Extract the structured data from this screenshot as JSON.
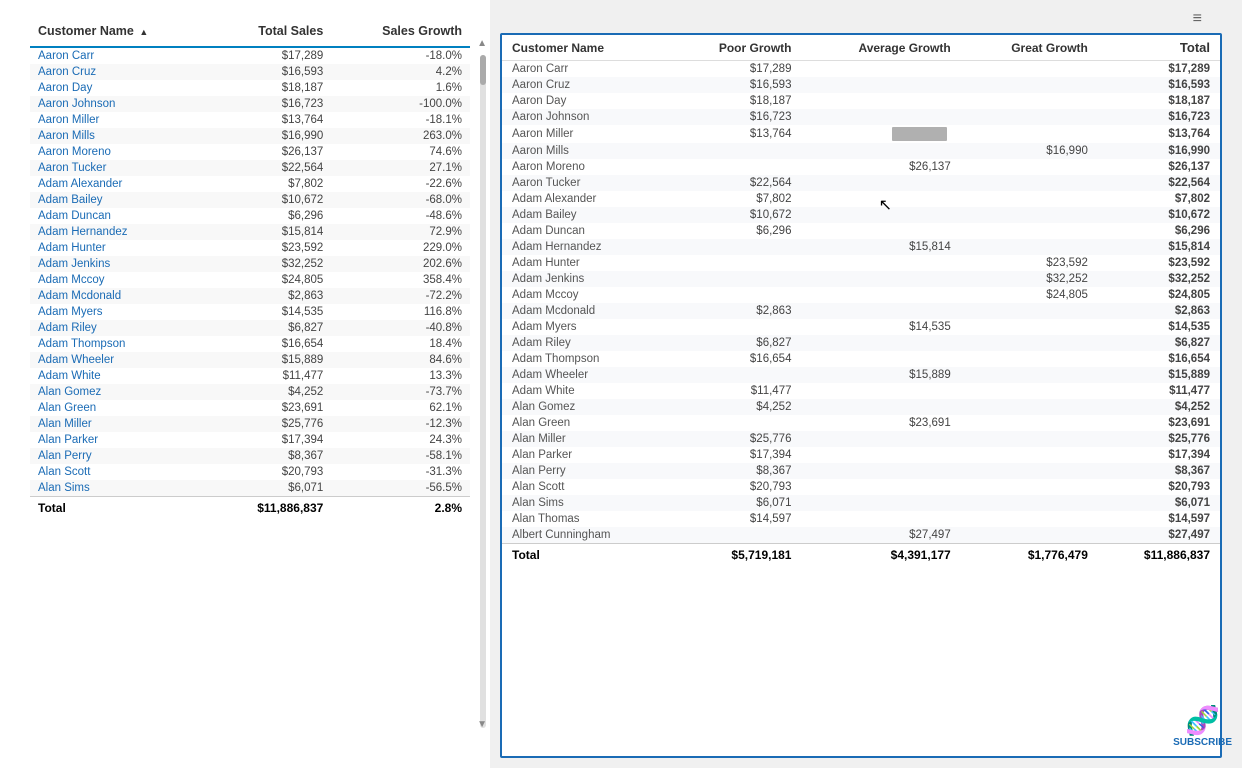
{
  "left": {
    "columns": [
      "Customer Name",
      "Total Sales",
      "Sales Growth"
    ],
    "rows": [
      [
        "Aaron Carr",
        "$17,289",
        "-18.0%"
      ],
      [
        "Aaron Cruz",
        "$16,593",
        "4.2%"
      ],
      [
        "Aaron Day",
        "$18,187",
        "1.6%"
      ],
      [
        "Aaron Johnson",
        "$16,723",
        "-100.0%"
      ],
      [
        "Aaron Miller",
        "$13,764",
        "-18.1%"
      ],
      [
        "Aaron Mills",
        "$16,990",
        "263.0%"
      ],
      [
        "Aaron Moreno",
        "$26,137",
        "74.6%"
      ],
      [
        "Aaron Tucker",
        "$22,564",
        "27.1%"
      ],
      [
        "Adam Alexander",
        "$7,802",
        "-22.6%"
      ],
      [
        "Adam Bailey",
        "$10,672",
        "-68.0%"
      ],
      [
        "Adam Duncan",
        "$6,296",
        "-48.6%"
      ],
      [
        "Adam Hernandez",
        "$15,814",
        "72.9%"
      ],
      [
        "Adam Hunter",
        "$23,592",
        "229.0%"
      ],
      [
        "Adam Jenkins",
        "$32,252",
        "202.6%"
      ],
      [
        "Adam Mccoy",
        "$24,805",
        "358.4%"
      ],
      [
        "Adam Mcdonald",
        "$2,863",
        "-72.2%"
      ],
      [
        "Adam Myers",
        "$14,535",
        "116.8%"
      ],
      [
        "Adam Riley",
        "$6,827",
        "-40.8%"
      ],
      [
        "Adam Thompson",
        "$16,654",
        "18.4%"
      ],
      [
        "Adam Wheeler",
        "$15,889",
        "84.6%"
      ],
      [
        "Adam White",
        "$11,477",
        "13.3%"
      ],
      [
        "Alan Gomez",
        "$4,252",
        "-73.7%"
      ],
      [
        "Alan Green",
        "$23,691",
        "62.1%"
      ],
      [
        "Alan Miller",
        "$25,776",
        "-12.3%"
      ],
      [
        "Alan Parker",
        "$17,394",
        "24.3%"
      ],
      [
        "Alan Perry",
        "$8,367",
        "-58.1%"
      ],
      [
        "Alan Scott",
        "$20,793",
        "-31.3%"
      ],
      [
        "Alan Sims",
        "$6,071",
        "-56.5%"
      ]
    ],
    "footer": [
      "Total",
      "$11,886,837",
      "2.8%"
    ]
  },
  "right": {
    "title": "Customer Name",
    "columns": [
      "Customer Name",
      "Poor Growth",
      "Average Growth",
      "Great Growth",
      "Total"
    ],
    "rows": [
      [
        "Aaron Carr",
        "$17,289",
        "",
        "",
        "$17,289"
      ],
      [
        "Aaron Cruz",
        "$16,593",
        "",
        "",
        "$16,593"
      ],
      [
        "Aaron Day",
        "$18,187",
        "",
        "",
        "$18,187"
      ],
      [
        "Aaron Johnson",
        "$16,723",
        "",
        "",
        "$16,723"
      ],
      [
        "Aaron Miller",
        "$13,764",
        "BAR",
        "",
        "$13,764"
      ],
      [
        "Aaron Mills",
        "",
        "",
        "$16,990",
        "$16,990"
      ],
      [
        "Aaron Moreno",
        "",
        "$26,137",
        "",
        "$26,137"
      ],
      [
        "Aaron Tucker",
        "$22,564",
        "",
        "",
        "$22,564"
      ],
      [
        "Adam Alexander",
        "$7,802",
        "",
        "",
        "$7,802"
      ],
      [
        "Adam Bailey",
        "$10,672",
        "",
        "",
        "$10,672"
      ],
      [
        "Adam Duncan",
        "$6,296",
        "",
        "",
        "$6,296"
      ],
      [
        "Adam Hernandez",
        "",
        "$15,814",
        "",
        "$15,814"
      ],
      [
        "Adam Hunter",
        "",
        "",
        "$23,592",
        "$23,592"
      ],
      [
        "Adam Jenkins",
        "",
        "",
        "$32,252",
        "$32,252"
      ],
      [
        "Adam Mccoy",
        "",
        "",
        "$24,805",
        "$24,805"
      ],
      [
        "Adam Mcdonald",
        "$2,863",
        "",
        "",
        "$2,863"
      ],
      [
        "Adam Myers",
        "",
        "$14,535",
        "",
        "$14,535"
      ],
      [
        "Adam Riley",
        "$6,827",
        "",
        "",
        "$6,827"
      ],
      [
        "Adam Thompson",
        "$16,654",
        "",
        "",
        "$16,654"
      ],
      [
        "Adam Wheeler",
        "",
        "$15,889",
        "",
        "$15,889"
      ],
      [
        "Adam White",
        "$11,477",
        "",
        "",
        "$11,477"
      ],
      [
        "Alan Gomez",
        "$4,252",
        "",
        "",
        "$4,252"
      ],
      [
        "Alan Green",
        "",
        "$23,691",
        "",
        "$23,691"
      ],
      [
        "Alan Miller",
        "$25,776",
        "",
        "",
        "$25,776"
      ],
      [
        "Alan Parker",
        "$17,394",
        "",
        "",
        "$17,394"
      ],
      [
        "Alan Perry",
        "$8,367",
        "",
        "",
        "$8,367"
      ],
      [
        "Alan Scott",
        "$20,793",
        "",
        "",
        "$20,793"
      ],
      [
        "Alan Sims",
        "$6,071",
        "",
        "",
        "$6,071"
      ],
      [
        "Alan Thomas",
        "$14,597",
        "",
        "",
        "$14,597"
      ],
      [
        "Albert Cunningham",
        "",
        "$27,497",
        "",
        "$27,497"
      ]
    ],
    "footer": [
      "Total",
      "$5,719,181",
      "$4,391,177",
      "$1,776,479",
      "$11,886,837"
    ]
  },
  "subscribe": {
    "label": "SUBSCRIBE",
    "icon": "dna"
  }
}
